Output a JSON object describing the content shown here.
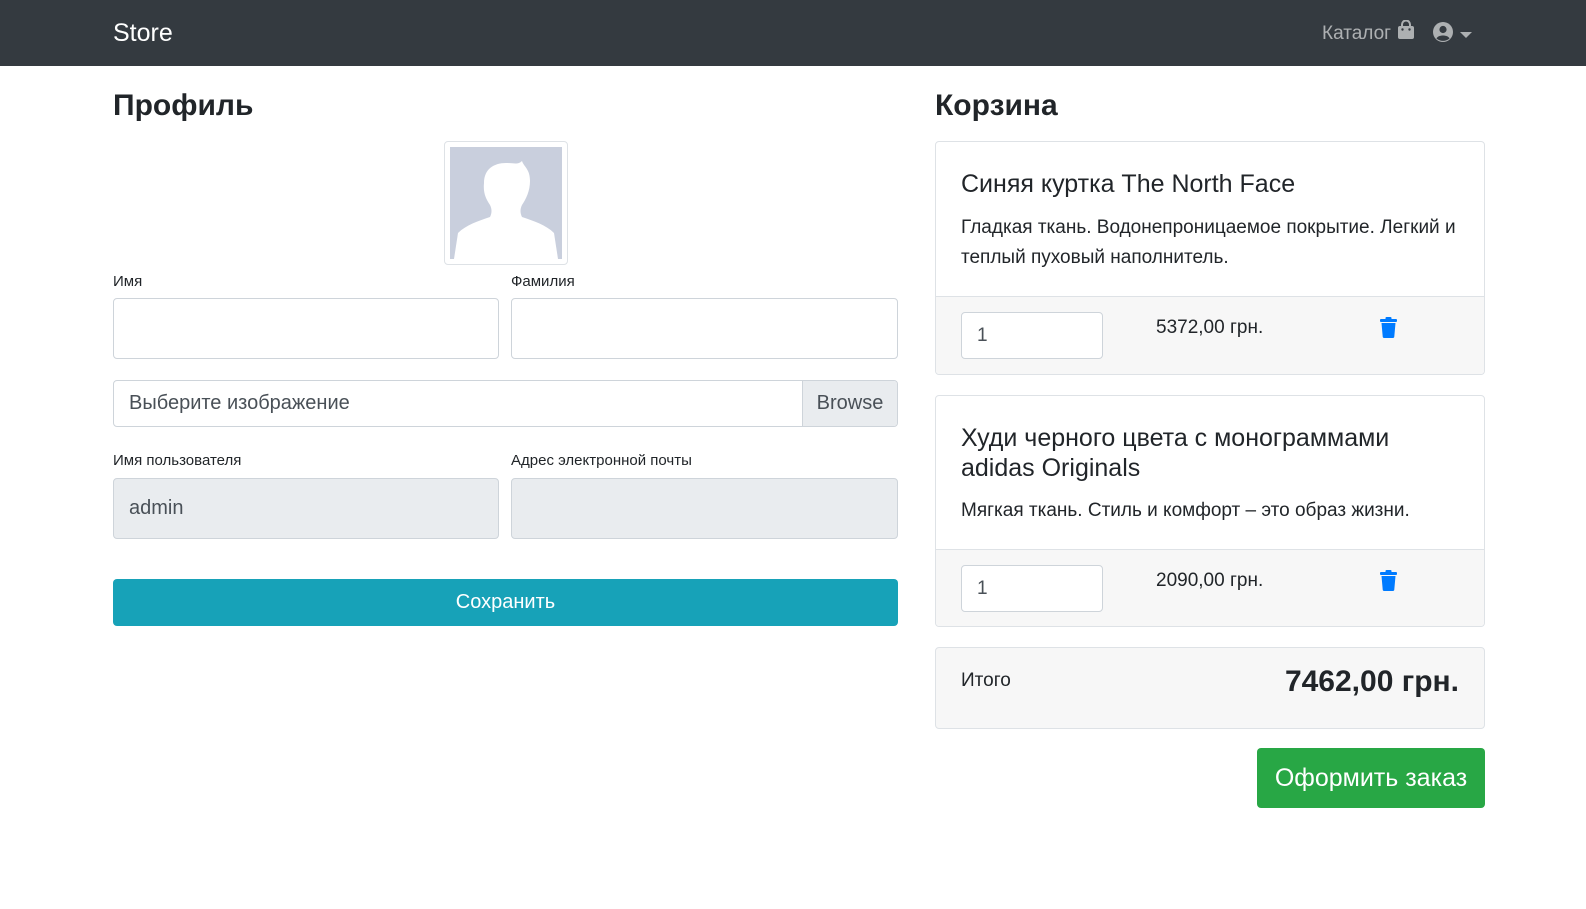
{
  "navbar": {
    "brand": "Store",
    "catalog_label": "Каталог",
    "icons": {
      "catalog": "shopping-bag-icon",
      "user": "user-circle-icon",
      "dropdown": "caret-down-icon"
    }
  },
  "profile": {
    "title": "Профиль",
    "avatar": "avatar-placeholder",
    "first_name_label": "Имя",
    "first_name_value": "",
    "last_name_label": "Фамилия",
    "last_name_value": "",
    "file_placeholder": "Выберите изображение",
    "browse_label": "Browse",
    "username_label": "Имя пользователя",
    "username_value": "admin",
    "email_label": "Адрес электронной почты",
    "email_value": "",
    "save_label": "Сохранить"
  },
  "cart": {
    "title": "Корзина",
    "items": [
      {
        "name": "Синяя куртка The North Face",
        "description": "Гладкая ткань. Водонепроницаемое покрытие. Легкий и теплый пуховый наполнитель.",
        "quantity": "1",
        "price": "5372,00 грн."
      },
      {
        "name": "Худи черного цвета с монограммами adidas Originals",
        "description": "Мягкая ткань. Стиль и комфорт – это образ жизни.",
        "quantity": "1",
        "price": "2090,00 грн."
      }
    ],
    "total_label": "Итого",
    "total_value": "7462,00 грн.",
    "order_label": "Оформить заказ"
  },
  "colors": {
    "navbar": "#343a40",
    "save_button": "#17a2b8",
    "order_button": "#28a745",
    "trash_icon": "#007bff"
  }
}
